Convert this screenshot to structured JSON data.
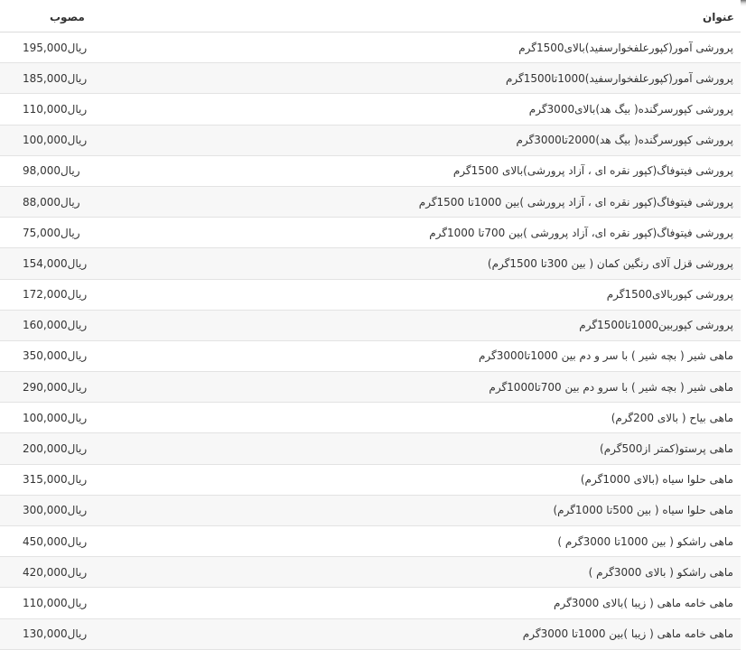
{
  "header": {
    "title_column": "عنوان",
    "price_column": "مصوب"
  },
  "rows": [
    {
      "title": "پرورشی آمور(کپورعلفخوارسفید)بالای1500گرم",
      "price": "195,000",
      "unit": "ریال"
    },
    {
      "title": "پرورشی آمور(کپورعلفخوارسفید)1000تا1500گرم",
      "price": "185,000",
      "unit": "ریال"
    },
    {
      "title": "پرورشی کپورسرگنده( بیگ هد)بالای3000گرم",
      "price": "110,000",
      "unit": "ریال"
    },
    {
      "title": "پرورشی کپورسرگنده( بیگ هد)2000تا3000گرم",
      "price": "100,000",
      "unit": "ریال"
    },
    {
      "title": "پرورشی فیتوفاگ(کپور نقره ای ، آزاد پرورشی)بالای 1500گرم",
      "price": "98,000",
      "unit": "ریال"
    },
    {
      "title": "پرورشی فیتوفاگ(کپور نقره ای ، آزاد پرورشی )بین 1000تا 1500گرم",
      "price": "88,000",
      "unit": "ریال"
    },
    {
      "title": "پرورشی فیتوفاگ(کپور نقره ای، آزاد پرورشی )بین 700تا 1000گرم",
      "price": "75,000",
      "unit": "ریال"
    },
    {
      "title": "پرورشی قزل آلای رنگین کمان ( بین 300تا 1500گرم)",
      "price": "154,000",
      "unit": "ریال"
    },
    {
      "title": "پرورشی کپوربالای1500گرم",
      "price": "172,000",
      "unit": "ریال"
    },
    {
      "title": "پرورشی کپوربین1000تا1500گرم",
      "price": "160,000",
      "unit": "ریال"
    },
    {
      "title": "ماهی شیر ( بچه شیر ) با سر و دم بین 1000تا3000گرم",
      "price": "350,000",
      "unit": "ریال"
    },
    {
      "title": "ماهی شیر ( بچه شیر ) با سرو دم بین 700تا1000گرم",
      "price": "290,000",
      "unit": "ریال"
    },
    {
      "title": "ماهی بیاح ( بالای 200گرم)",
      "price": "100,000",
      "unit": "ریال"
    },
    {
      "title": "ماهی پرستو(کمتر از500گرم)",
      "price": "200,000",
      "unit": "ریال"
    },
    {
      "title": "ماهی حلوا سیاه (بالای 1000گرم)",
      "price": "315,000",
      "unit": "ریال"
    },
    {
      "title": "ماهی حلوا سیاه ( بین 500تا 1000گرم)",
      "price": "300,000",
      "unit": "ریال"
    },
    {
      "title": "ماهی راشکو ( بین 1000تا 3000گرم )",
      "price": "450,000",
      "unit": "ریال"
    },
    {
      "title": "ماهی راشکو ( بالای 3000گرم )",
      "price": "420,000",
      "unit": "ریال"
    },
    {
      "title": "ماهی خامه ماهی ( زیبا )بالای 3000گرم",
      "price": "110,000",
      "unit": "ریال"
    },
    {
      "title": "ماهی خامه ماهی ( زیبا )بین 1000تا 3000گرم",
      "price": "130,000",
      "unit": "ریال"
    }
  ]
}
